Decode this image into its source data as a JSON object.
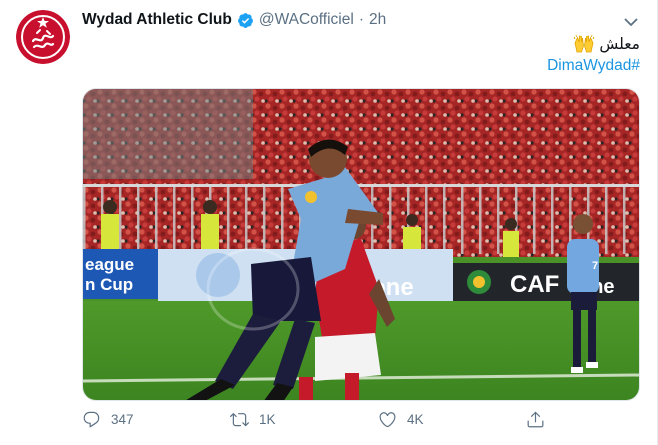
{
  "tweet": {
    "display_name": "Wydad Athletic Club",
    "handle": "@WACofficiel",
    "separator": "·",
    "time": "2h",
    "text": "معلش",
    "emoji": "raised-hands-emoji",
    "hashtag": "#DimaWydad",
    "verified_icon": "verified-badge-icon",
    "avatar_logo": "wydad-crest-logo"
  },
  "media": {
    "boards": {
      "board1_line1": "eague",
      "board1_line2": "n Cup",
      "board2": "one",
      "board3_caf": "CAF",
      "board3_tail": "one"
    },
    "jersey_number": "7"
  },
  "actions": {
    "reply_count": "347",
    "retweet_count": "1K",
    "like_count": "4K",
    "reply_icon": "reply-icon",
    "retweet_icon": "retweet-icon",
    "like_icon": "heart-icon",
    "share_icon": "share-icon"
  },
  "colors": {
    "accent": "#1da1f2",
    "hashtag": "#1b95e0",
    "muted": "#5b7083",
    "wydad_red": "#c8102e"
  }
}
